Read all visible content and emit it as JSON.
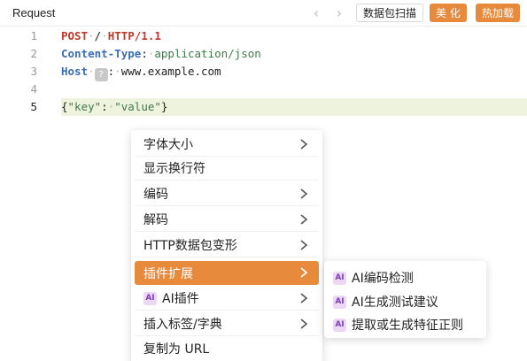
{
  "header": {
    "title": "Request",
    "prev_icon": "chevron-left-icon",
    "next_icon": "chevron-right-icon",
    "scan_button": "数据包扫描",
    "beautify_button": "美 化",
    "hot_load_button": "热加载",
    "accent_color": "#e88a3b"
  },
  "editor": {
    "lines": [
      {
        "num": "1",
        "method": "POST",
        "path": "/",
        "version": "HTTP/1.1"
      },
      {
        "num": "2",
        "header_name": "Content-Type",
        "header_value": "application/json"
      },
      {
        "num": "3",
        "header_name": "Host",
        "badge": "?",
        "header_value": "www.example.com"
      },
      {
        "num": "4"
      },
      {
        "num": "5",
        "open": "{",
        "key": "\"key\"",
        "colon": ":",
        "value": "\"value\"",
        "close": "}"
      }
    ],
    "active_line": 5
  },
  "context_menu": {
    "items": [
      {
        "label": "字体大小",
        "has_submenu": true
      },
      {
        "label": "显示换行符",
        "has_submenu": false
      },
      {
        "label": "编码",
        "has_submenu": true
      },
      {
        "label": "解码",
        "has_submenu": true
      },
      {
        "label": "HTTP数据包变形",
        "has_submenu": true
      },
      {
        "label": "插件扩展",
        "has_submenu": true,
        "highlighted": true
      },
      {
        "label": "AI插件",
        "has_submenu": true,
        "icon": "ai-icon"
      },
      {
        "label": "插入标签/字典",
        "has_submenu": true
      },
      {
        "label": "复制为 URL",
        "has_submenu": false
      }
    ],
    "ai_icon_text": "AI"
  },
  "submenu": {
    "items": [
      {
        "label": "AI编码检测",
        "icon": "ai-icon"
      },
      {
        "label": "AI生成测试建议",
        "icon": "ai-icon"
      },
      {
        "label": "提取或生成特征正则",
        "icon": "ai-icon"
      }
    ]
  }
}
